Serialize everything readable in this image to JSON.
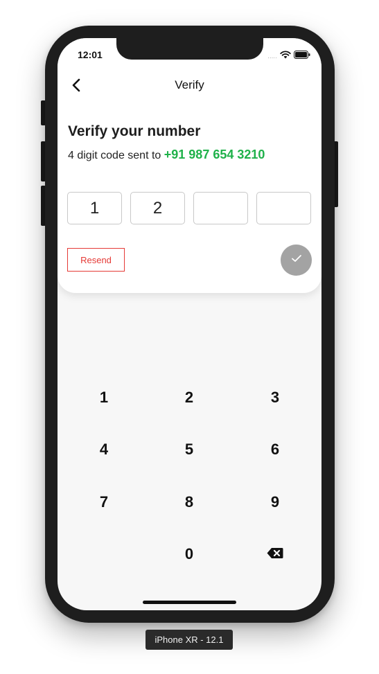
{
  "status_bar": {
    "time": "12:01",
    "signal_dots": "....."
  },
  "nav": {
    "title": "Verify"
  },
  "content": {
    "heading": "Verify your number",
    "subtitle_prefix": "4 digit code sent to",
    "phone_number": "+91 987 654 3210"
  },
  "code": {
    "digits": [
      "1",
      "2",
      "",
      ""
    ]
  },
  "actions": {
    "resend_label": "Resend"
  },
  "keypad": {
    "keys": [
      "1",
      "2",
      "3",
      "4",
      "5",
      "6",
      "7",
      "8",
      "9",
      "",
      "0",
      "backspace"
    ]
  },
  "device": {
    "label": "iPhone XR - 12.1"
  },
  "colors": {
    "accent_green": "#1fb14a",
    "resend_red": "#e53935",
    "confirm_disabled": "#a3a3a3"
  },
  "icons": {
    "back": "chevron-left-icon",
    "confirm": "checkmark-icon",
    "backspace": "backspace-icon",
    "wifi": "wifi-icon",
    "battery": "battery-icon"
  }
}
